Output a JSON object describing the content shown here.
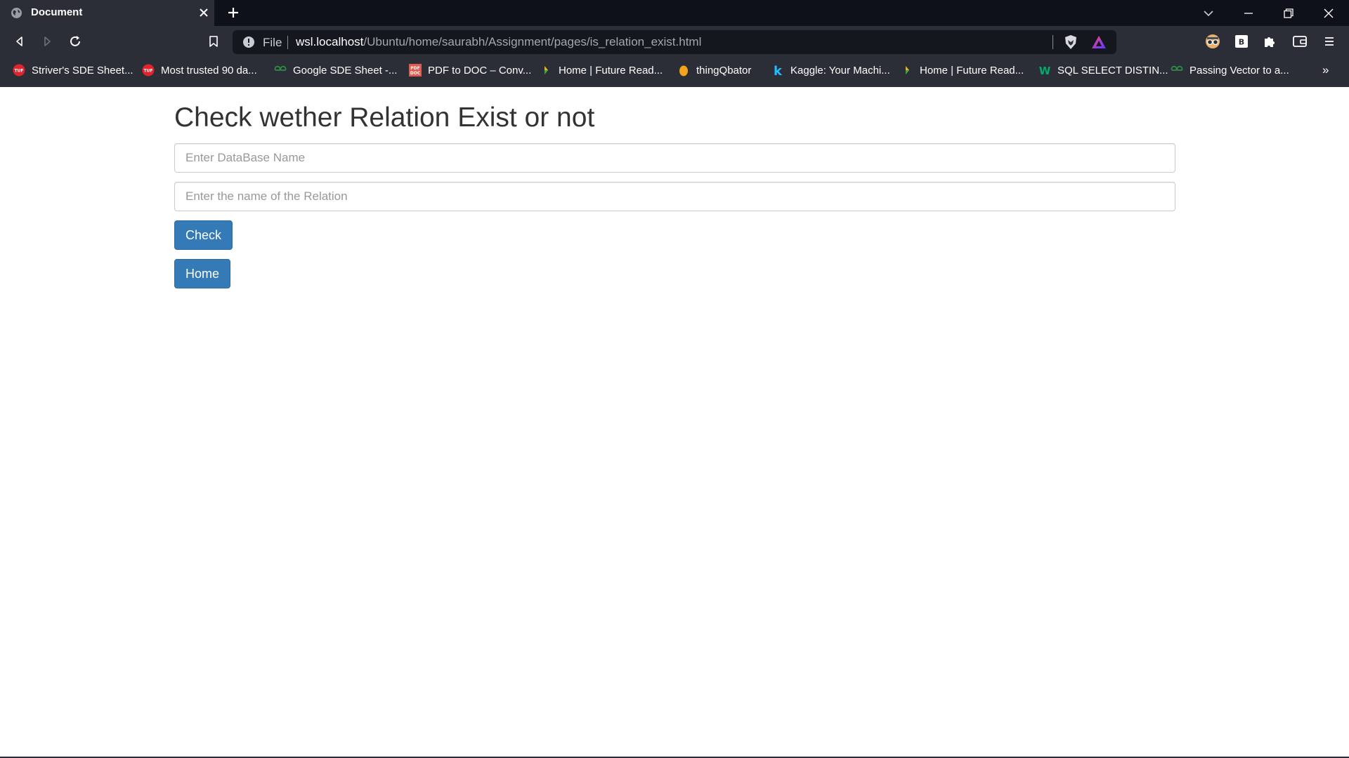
{
  "tab": {
    "title": "Document"
  },
  "address_bar": {
    "scheme_label": "File",
    "host": "wsl.localhost",
    "path": "/Ubuntu/home/saurabh/Assignment/pages/is_relation_exist.html"
  },
  "bookmarks": [
    {
      "label": "Striver's SDE Sheet...",
      "icon": "tuf-icon"
    },
    {
      "label": "Most trusted 90 da...",
      "icon": "tuf-icon"
    },
    {
      "label": "Google SDE Sheet -...",
      "icon": "gfg-icon"
    },
    {
      "label": "PDF to DOC – Conv...",
      "icon": "pdf-doc-icon"
    },
    {
      "label": "Home | Future Read...",
      "icon": "future-read-icon"
    },
    {
      "label": "thingQbator",
      "icon": "thingqbator-icon"
    },
    {
      "label": "Kaggle: Your Machi...",
      "icon": "kaggle-icon"
    },
    {
      "label": "Home | Future Read...",
      "icon": "future-read-icon"
    },
    {
      "label": "SQL SELECT DISTIN...",
      "icon": "w3schools-icon"
    },
    {
      "label": "Passing Vector to a...",
      "icon": "gfg-icon"
    }
  ],
  "bookmarks_more": "»",
  "page": {
    "heading": "Check wether Relation Exist or not",
    "database_input": {
      "placeholder": "Enter DataBase Name",
      "value": ""
    },
    "relation_input": {
      "placeholder": "Enter the name of the Relation",
      "value": ""
    },
    "check_button": "Check",
    "home_button": "Home"
  },
  "colors": {
    "chrome_dark": "#0f111a",
    "chrome": "#2b2d37",
    "button_primary": "#337ab7",
    "heading_text": "#333333"
  }
}
